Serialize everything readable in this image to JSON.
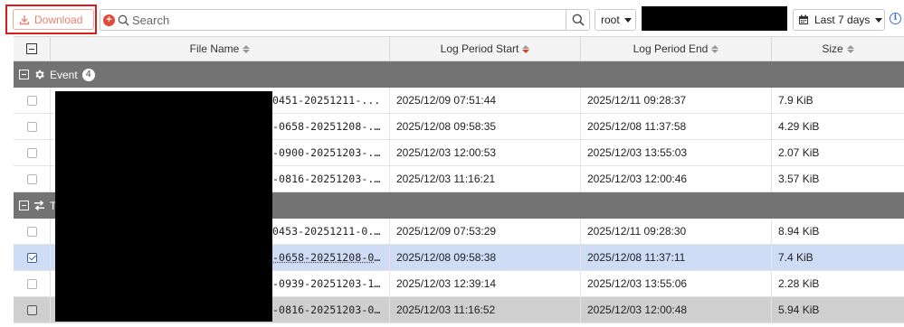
{
  "toolbar": {
    "download_label": "Download",
    "search_placeholder": "Search",
    "root_label": "root",
    "date_range_label": "Last 7 days"
  },
  "table": {
    "columns": [
      "File Name",
      "Log Period Start",
      "Log Period End",
      "Size"
    ],
    "sorted_column": "Log Period Start",
    "groups": [
      {
        "name": "Event",
        "count": "4",
        "rows": [
          {
            "file": "-0451-20251211-...",
            "start": "2025/12/09 07:51:44",
            "end": "2025/12/11 09:28:37",
            "size": "7.9 KiB",
            "checked": false
          },
          {
            "file": "3-0658-20251208-...",
            "start": "2025/12/08 09:58:35",
            "end": "2025/12/08 11:37:58",
            "size": "4.29 KiB",
            "checked": false
          },
          {
            "file": "3-0900-20251203-...",
            "start": "2025/12/03 12:00:53",
            "end": "2025/12/03 13:55:03",
            "size": "2.07 KiB",
            "checked": false
          },
          {
            "file": "3-0816-20251203-...",
            "start": "2025/12/03 11:16:21",
            "end": "2025/12/03 12:00:46",
            "size": "3.57 KiB",
            "checked": false
          }
        ]
      },
      {
        "name": "T",
        "count": "",
        "rows": [
          {
            "file": "-0453-20251211-0...",
            "start": "2025/12/09 07:53:29",
            "end": "2025/12/11 09:28:30",
            "size": "8.94 KiB",
            "checked": false
          },
          {
            "file": "3-0658-20251208-0...",
            "start": "2025/12/08 09:58:38",
            "end": "2025/12/08 11:37:11",
            "size": "7.4 KiB",
            "checked": true
          },
          {
            "file": "3-0939-20251203-1...",
            "start": "2025/12/03 12:39:14",
            "end": "2025/12/03 13:55:06",
            "size": "2.28 KiB",
            "checked": false
          },
          {
            "file": "3-0816-20251203-0...",
            "start": "2025/12/03 11:16:52",
            "end": "2025/12/03 12:00:48",
            "size": "5.94 KiB",
            "checked": false
          }
        ]
      }
    ]
  }
}
